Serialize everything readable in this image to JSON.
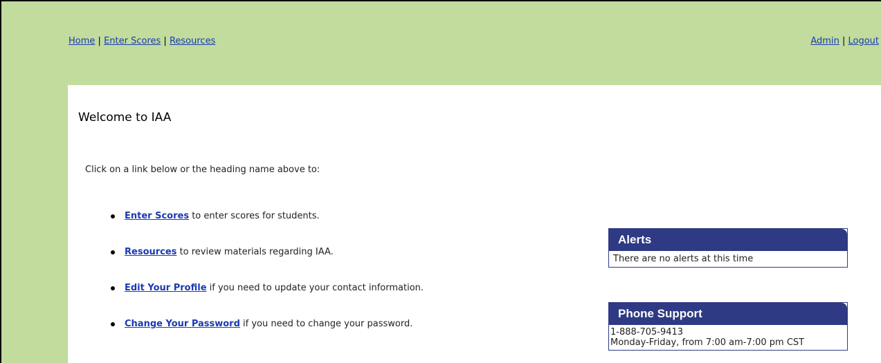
{
  "nav": {
    "left": [
      "Home",
      "Enter Scores",
      "Resources"
    ],
    "right": [
      "Admin",
      "Logout"
    ],
    "separator": "|"
  },
  "main": {
    "title": "Welcome to IAA",
    "intro": "Click on a link below or the heading name above to:",
    "links": [
      {
        "label": "Enter Scores",
        "desc": " to enter scores for students."
      },
      {
        "label": "Resources",
        "desc": " to review materials regarding IAA."
      },
      {
        "label": "Edit Your Profile",
        "desc": " if you need to update your contact information."
      },
      {
        "label": "Change Your Password",
        "desc": " if you need to change your password."
      }
    ]
  },
  "alerts": {
    "title": "Alerts",
    "message": "There are no alerts at this time"
  },
  "phone_support": {
    "title": "Phone Support",
    "number": "1-888-705-9413",
    "hours": "Monday-Friday, from 7:00 am-7:00 pm CST"
  },
  "colors": {
    "background": "#c1dc9c",
    "box_header": "#2e3a84",
    "link": "#1a3ab3"
  }
}
